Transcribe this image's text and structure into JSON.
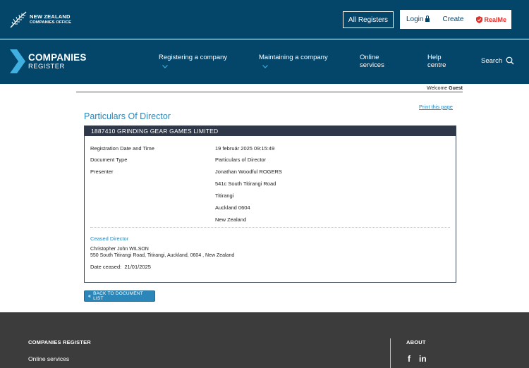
{
  "header": {
    "org_line1": "NEW ZEALAND",
    "org_line2": "COMPANIES OFFICE",
    "all_registers": "All Registers",
    "login": "Login",
    "create": "Create",
    "realme": "RealMe"
  },
  "nav": {
    "brand_line1": "COMPANIES",
    "brand_line2": "REGISTER",
    "items": [
      {
        "label": "Registering a company"
      },
      {
        "label": "Maintaining a company"
      },
      {
        "label_line1": "Online",
        "label_line2": "services"
      },
      {
        "label_line1": "Help",
        "label_line2": "centre"
      }
    ],
    "search": "Search"
  },
  "welcome": {
    "prefix": "Welcome",
    "user": "Guest"
  },
  "page": {
    "title": "Particulars Of Director",
    "print_link": "Print this page",
    "panel_header": "1887410  GRINDING GEAR GAMES LIMITED",
    "fields": [
      {
        "label": "Registration Date and Time",
        "value": "19 február 2025 09:15:49"
      },
      {
        "label": "Document Type",
        "value": "Particulars of Director"
      },
      {
        "label": "Presenter",
        "value": "Jonathan Woodful ROGERS"
      }
    ],
    "presenter_address": [
      "541c South Titirangi Road",
      "Titirangi",
      "Auckland 0604",
      "New Zealand"
    ],
    "ceased": {
      "heading": "Ceased Director",
      "name": "Christopher John WILSON",
      "address": "550 South Titirangi Road, Titirangi, Auckland, 0604 , New Zealand",
      "date_label": "Date ceased:",
      "date_value": "21/01/2025"
    },
    "back_button": "BACK TO DOCUMENT LIST"
  },
  "footer": {
    "section1": "COMPANIES REGISTER",
    "link1": "Online services",
    "section2": "ABOUT",
    "social": [
      "facebook-icon",
      "linkedin-icon"
    ]
  },
  "colors": {
    "brand": "#04456a",
    "link": "#2b87b9",
    "panel_head": "#2f3848",
    "footer": "#3c3c3c",
    "realme": "#e0322c"
  }
}
